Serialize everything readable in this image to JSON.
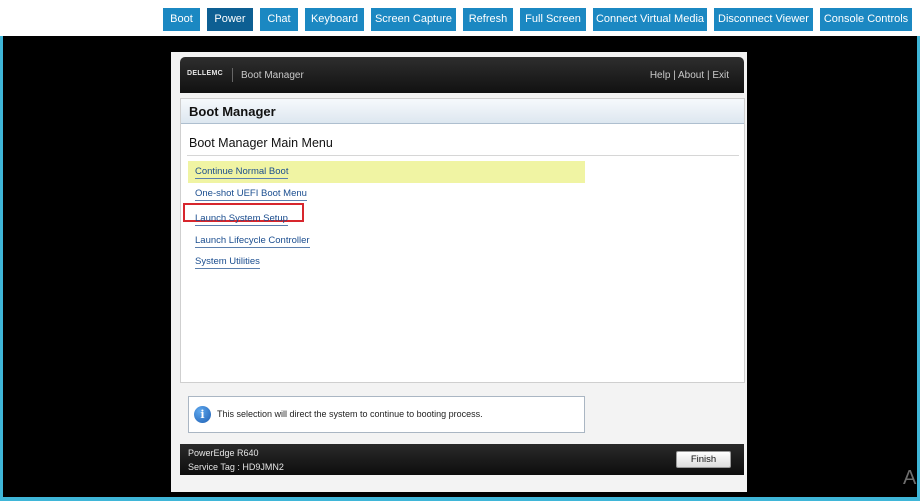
{
  "toolbar": {
    "buttons": [
      "Boot",
      "Power",
      "Chat",
      "Keyboard",
      "Screen Capture",
      "Refresh",
      "Full Screen",
      "Connect Virtual Media",
      "Disconnect Viewer",
      "Console Controls"
    ],
    "active": "Power"
  },
  "header": {
    "logo": "DELLEMC",
    "title": "Boot Manager",
    "links": {
      "help": "Help",
      "about": "About",
      "exit": "Exit",
      "separator": "|"
    }
  },
  "panel": {
    "title": "Boot Manager",
    "menu_heading": "Boot Manager Main Menu",
    "items": [
      "Continue Normal Boot",
      "One-shot UEFI Boot Menu",
      "Launch System Setup",
      "Launch Lifecycle Controller",
      "System Utilities"
    ],
    "highlighted_item": "Continue Normal Boot",
    "marked_item": "Launch System Setup"
  },
  "info": {
    "icon": "info-icon",
    "text": "This selection will direct the system to continue to booting process."
  },
  "footer": {
    "model": "PowerEdge R640",
    "service_tag": "Service Tag : HD9JMN2",
    "finish_label": "Finish"
  },
  "corner_glyph": "A",
  "colors": {
    "toolbar_button": "#1b88c2",
    "toolbar_active": "#0d5f93",
    "highlight": "#f0f4a3",
    "marker": "#d7262d",
    "page_border": "#3fb6d8"
  }
}
